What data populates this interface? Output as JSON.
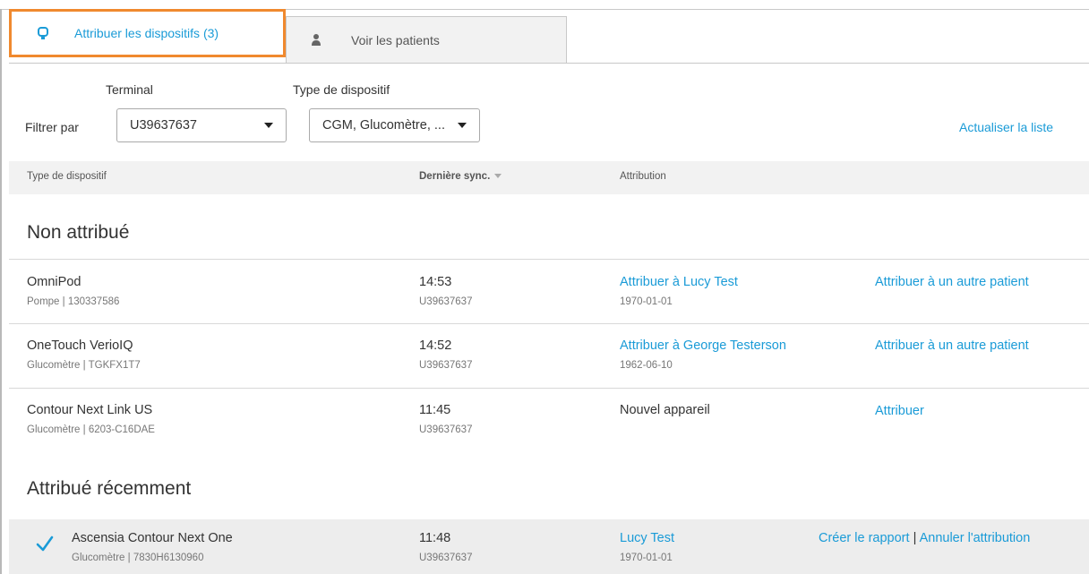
{
  "tabs": [
    {
      "label": "Attribuer les dispositifs (3)",
      "active": true,
      "icon": "device-pin-icon"
    },
    {
      "label": "Voir les patients",
      "active": false,
      "icon": "person-icon"
    }
  ],
  "filters": {
    "filter_by_label": "Filtrer par",
    "terminal": {
      "label": "Terminal",
      "value": "U39637637"
    },
    "device_type": {
      "label": "Type de dispositif",
      "value": "CGM, Glucomètre, ..."
    },
    "refresh_label": "Actualiser la liste"
  },
  "columns": {
    "device_type": "Type de dispositif",
    "last_sync": "Dernière sync.",
    "assignment": "Attribution"
  },
  "sections": {
    "unassigned": "Non attribué",
    "recent": "Attribué récemment"
  },
  "unassigned_rows": [
    {
      "device": "OmniPod",
      "detail": "Pompe | 130337586",
      "time": "14:53",
      "terminal": "U39637637",
      "assign_link": "Attribuer à Lucy Test",
      "assign_date": "1970-01-01",
      "action": "Attribuer à un autre patient"
    },
    {
      "device": "OneTouch VerioIQ",
      "detail": "Glucomètre | TGKFX1T7",
      "time": "14:52",
      "terminal": "U39637637",
      "assign_link": "Attribuer à George Testerson",
      "assign_date": "1962-06-10",
      "action": "Attribuer à un autre patient"
    },
    {
      "device": "Contour Next Link US",
      "detail": "Glucomètre | 6203-C16DAE",
      "time": "11:45",
      "terminal": "U39637637",
      "assign_text": "Nouvel appareil",
      "action": "Attribuer"
    }
  ],
  "recent_rows": [
    {
      "device": "Ascensia Contour Next One",
      "detail": "Glucomètre | 7830H6130960",
      "time": "11:48",
      "terminal": "U39637637",
      "patient": "Lucy Test",
      "patient_date": "1970-01-01",
      "report_action": "Créer le rapport",
      "separator": "|",
      "cancel_action": "Annuler l'attribution",
      "status_icon": "checkmark-icon"
    }
  ],
  "colors": {
    "accent": "#1a9bd7",
    "highlight": "#f0892e"
  }
}
